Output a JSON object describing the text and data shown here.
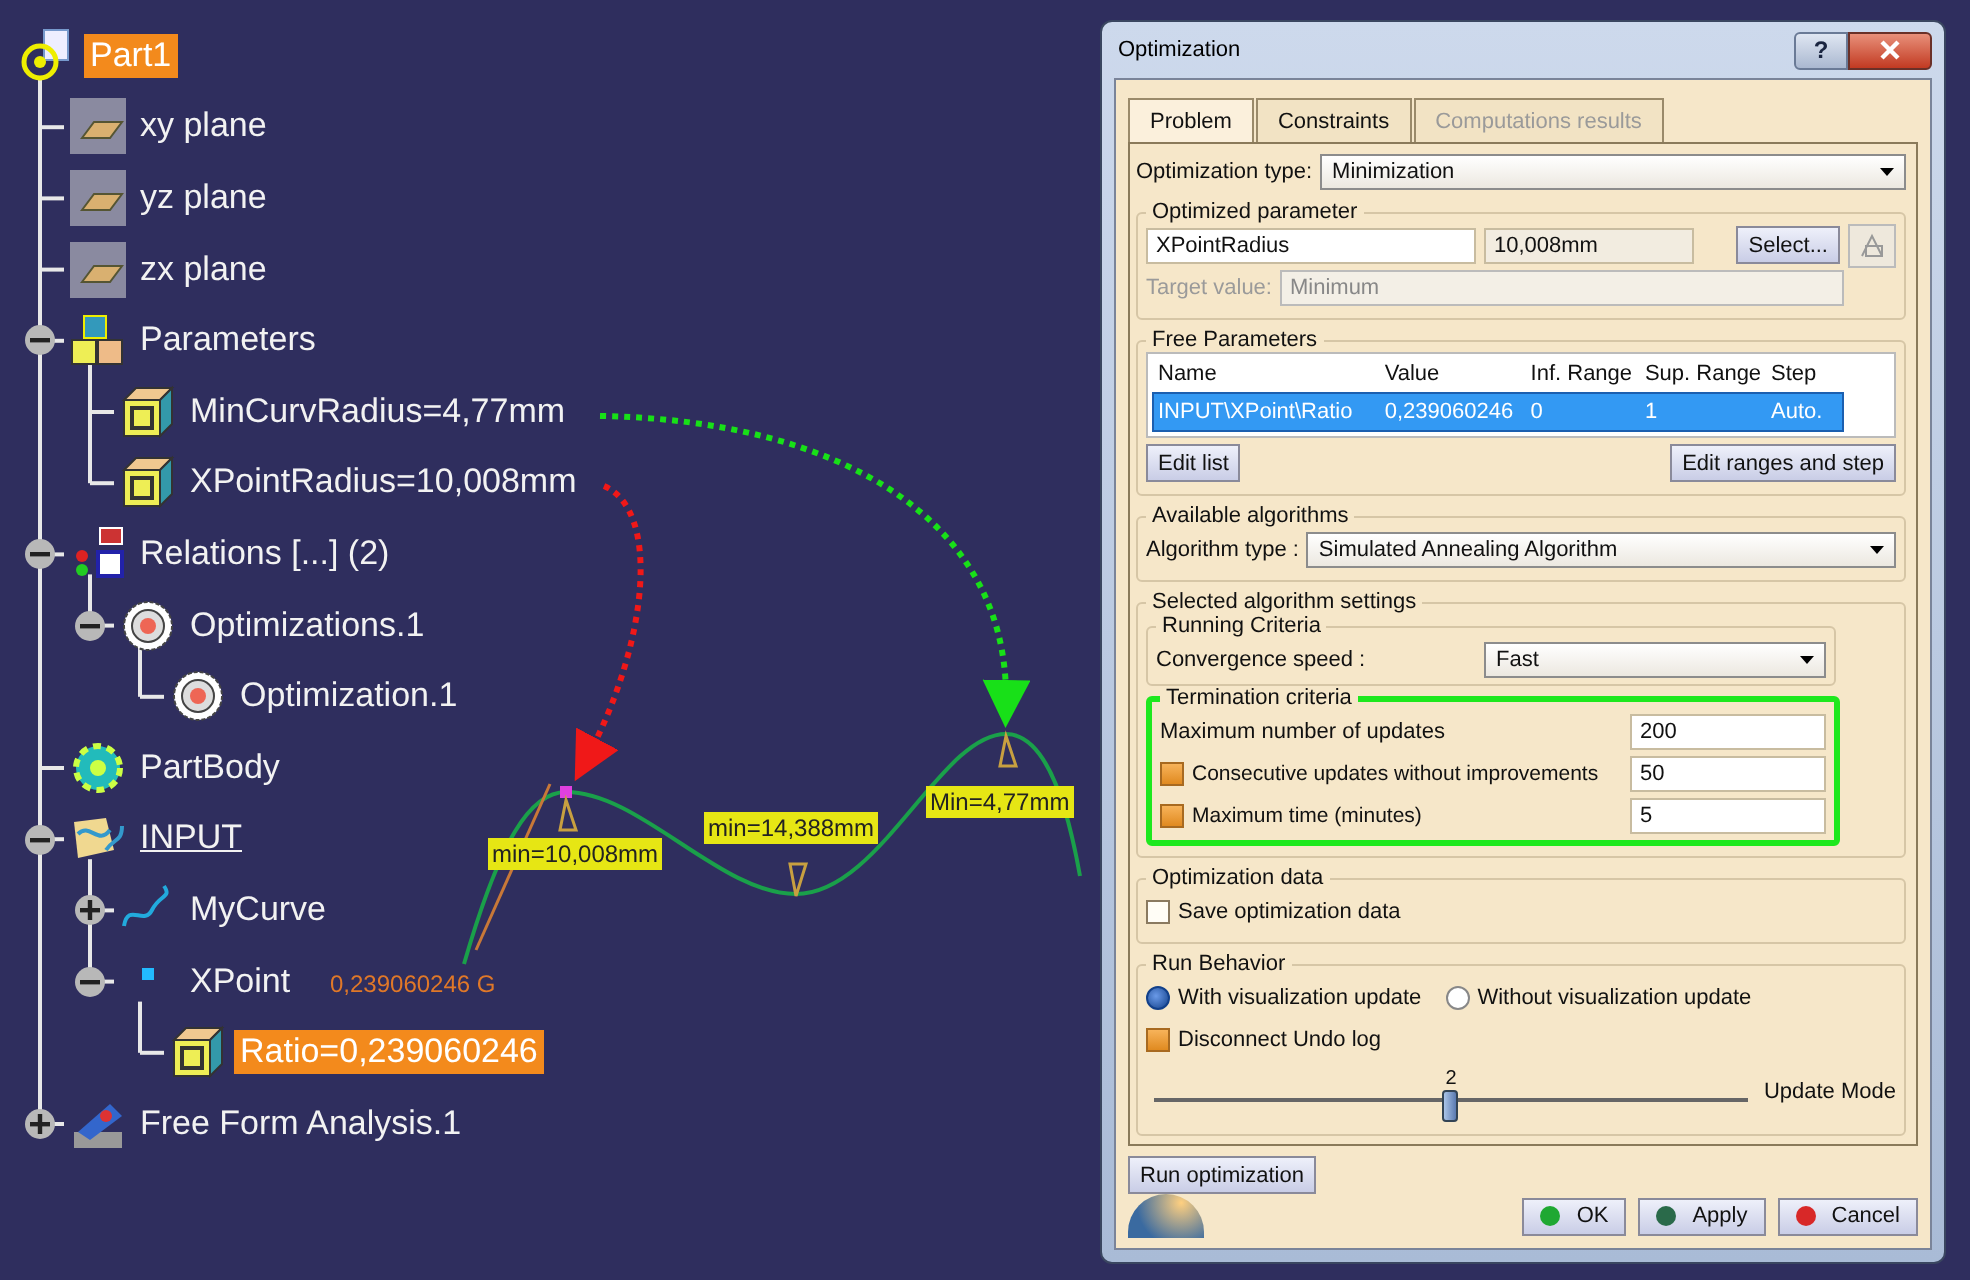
{
  "tree": {
    "label": "Part1",
    "kind": "part",
    "selected": true,
    "in_work": false,
    "children": [
      {
        "label": "xy plane",
        "kind": "plane",
        "selected": false,
        "in_work": false
      },
      {
        "label": "yz plane",
        "kind": "plane",
        "selected": false,
        "in_work": false
      },
      {
        "label": "zx plane",
        "kind": "plane",
        "selected": false,
        "in_work": false
      },
      {
        "label": "Parameters",
        "kind": "parameter_set",
        "selected": false,
        "in_work": false,
        "expanded": true,
        "children": [
          {
            "label": "MinCurvRadius=4,77mm",
            "kind": "parameter",
            "selected": false,
            "in_work": false
          },
          {
            "label": "XPointRadius=10,008mm",
            "kind": "parameter",
            "selected": false,
            "in_work": false
          }
        ]
      },
      {
        "label": "Relations [...] (2)",
        "kind": "relations",
        "selected": false,
        "in_work": false,
        "expanded": true,
        "children": [
          {
            "label": "Optimizations.1",
            "kind": "optimization",
            "selected": false,
            "in_work": false,
            "expanded": true,
            "children": [
              {
                "label": "Optimization.1",
                "kind": "optimization",
                "selected": false,
                "in_work": false
              }
            ]
          }
        ]
      },
      {
        "label": "PartBody",
        "kind": "body",
        "selected": false,
        "in_work": false
      },
      {
        "label": "INPUT",
        "kind": "geometrical_set",
        "selected": false,
        "in_work": true,
        "expanded": true,
        "children": [
          {
            "label": "MyCurve",
            "kind": "curve",
            "selected": false,
            "in_work": false,
            "expanded": false
          },
          {
            "label": "XPoint",
            "kind": "point",
            "selected": false,
            "in_work": false,
            "expanded": true,
            "children": [
              {
                "label": "Ratio=0,239060246",
                "kind": "parameter",
                "selected": true,
                "in_work": false
              }
            ]
          }
        ]
      },
      {
        "label": "Free Form Analysis.1",
        "kind": "analysis",
        "selected": false,
        "in_work": false,
        "expanded": false
      }
    ]
  },
  "canvas": {
    "labels": [
      "min=10,008mm",
      "min=14,388mm",
      "Min=4,77mm"
    ],
    "ratio_label": "0,239060246 G"
  },
  "dialog": {
    "title": "Optimization",
    "help_button": "?",
    "tabs": [
      {
        "label": "Problem",
        "selected": true,
        "disabled": false
      },
      {
        "label": "Constraints",
        "selected": false,
        "disabled": false
      },
      {
        "label": "Computations results",
        "selected": false,
        "disabled": true
      }
    ],
    "optimization_type": {
      "label": "Optimization type:",
      "value": "Minimization"
    },
    "optimized_parameter": {
      "title": "Optimized parameter",
      "name": "XPointRadius",
      "value": "10,008mm",
      "select_button": "Select...",
      "target_label": "Target value:",
      "target_value": "Minimum",
      "target_disabled": true
    },
    "free_parameters": {
      "title": "Free Parameters",
      "columns": [
        "Name",
        "Value",
        "Inf. Range",
        "Sup. Range",
        "Step"
      ],
      "rows": [
        {
          "cells": [
            "INPUT\\XPoint\\Ratio",
            "0,239060246",
            "0",
            "1",
            "Auto."
          ],
          "selected": true
        }
      ],
      "buttons": [
        "Edit list",
        "Edit ranges and step"
      ]
    },
    "available_algorithms": {
      "title": "Available algorithms",
      "label": "Algorithm type :",
      "value": "Simulated Annealing Algorithm"
    },
    "algorithm_settings": {
      "title": "Selected algorithm settings",
      "running": {
        "title": "Running Criteria",
        "label": "Convergence speed :",
        "value": "Fast"
      },
      "termination": {
        "title": "Termination criteria",
        "highlighted": true,
        "max_updates": {
          "label": "Maximum number of updates",
          "value": "200"
        },
        "options": [
          {
            "label": "Consecutive updates without improvements",
            "checked": true,
            "value": "50"
          },
          {
            "label": "Maximum time (minutes)",
            "checked": true,
            "value": "5"
          }
        ]
      }
    },
    "optimization_data": {
      "title": "Optimization data",
      "save": {
        "label": "Save optimization data",
        "checked": false
      }
    },
    "run_behavior": {
      "title": "Run Behavior",
      "modes": [
        {
          "label": "With visualization update",
          "selected": true
        },
        {
          "label": "Without visualization update",
          "selected": false
        }
      ],
      "disconnect_undo": {
        "label": "Disconnect Undo log",
        "checked": true
      },
      "update_mode": {
        "label": "Update Mode",
        "reading": "2",
        "level": 0.5
      }
    },
    "run_button": "Run optimization",
    "buttons": [
      {
        "label": "OK",
        "color": "#1fa832"
      },
      {
        "label": "Apply",
        "color": "#2a6a4a"
      },
      {
        "label": "Cancel",
        "color": "#d82828"
      }
    ]
  }
}
